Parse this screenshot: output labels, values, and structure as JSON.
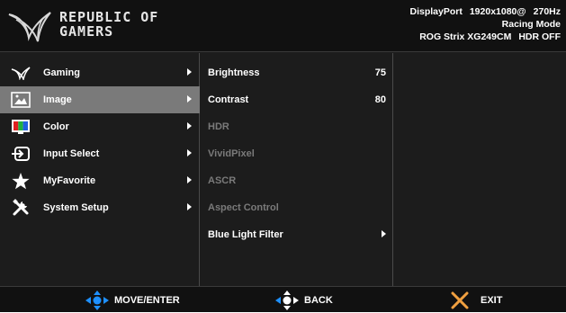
{
  "header": {
    "logo_line1": "REPUBLIC OF",
    "logo_line2": "GAMERS",
    "info_line1_port": "DisplayPort",
    "info_line1_res": "1920x1080@",
    "info_line1_hz": "270Hz",
    "info_line2": "Racing Mode",
    "info_line3_model": "ROG Strix XG249CM",
    "info_line3_hdr": "HDR OFF"
  },
  "menu": {
    "items": [
      {
        "label": "Gaming",
        "icon": "rog-claw-icon"
      },
      {
        "label": "Image",
        "icon": "picture-icon",
        "selected": true
      },
      {
        "label": "Color",
        "icon": "color-monitor-icon"
      },
      {
        "label": "Input Select",
        "icon": "input-select-icon"
      },
      {
        "label": "MyFavorite",
        "icon": "star-icon"
      },
      {
        "label": "System Setup",
        "icon": "tools-icon"
      }
    ]
  },
  "submenu": {
    "items": [
      {
        "label": "Brightness",
        "value": "75",
        "enabled": true
      },
      {
        "label": "Contrast",
        "value": "80",
        "enabled": true
      },
      {
        "label": "HDR",
        "enabled": false
      },
      {
        "label": "VividPixel",
        "enabled": false
      },
      {
        "label": "ASCR",
        "enabled": false
      },
      {
        "label": "Aspect Control",
        "enabled": false
      },
      {
        "label": "Blue Light Filter",
        "enabled": true,
        "has_submenu": true
      }
    ]
  },
  "footer": {
    "move_enter": "MOVE/ENTER",
    "back": "BACK",
    "exit": "EXIT"
  },
  "colors": {
    "joystick_blue": "#1e90ff",
    "selected_bg": "#7a7a7a",
    "disabled_text": "#7a7a7a",
    "exit_orange": "#f0a040"
  }
}
